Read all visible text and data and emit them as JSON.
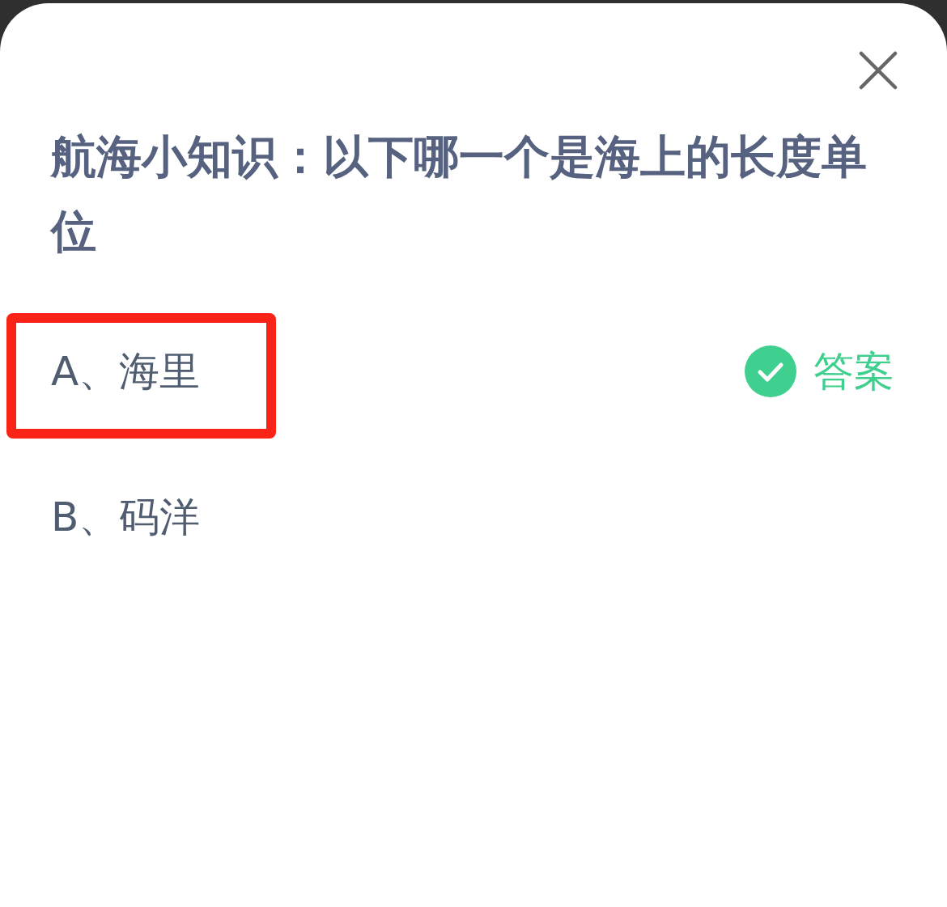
{
  "question": {
    "title": "航海小知识：以下哪一个是海上的长度单位"
  },
  "options": [
    {
      "text": "A、海里",
      "highlighted": true,
      "answer_label": "答案"
    },
    {
      "text": "B、码洋",
      "highlighted": false
    }
  ]
}
